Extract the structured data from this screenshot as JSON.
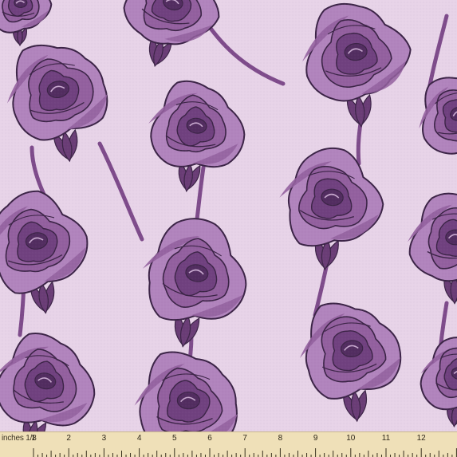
{
  "image": {
    "subject": "rose-pattern-fabric-swatch",
    "colors": {
      "background": "#e7d3e8",
      "petal_light": "#b184bd",
      "petal_mid": "#93609f",
      "petal_dark": "#70417f",
      "petal_deep": "#522d60",
      "outline": "#3c2447",
      "leaf": "#6a3d76",
      "stem": "#7e4b8b"
    }
  },
  "ruler": {
    "unit_label": "inches 1/8",
    "numbers": [
      "1",
      "2",
      "3",
      "4",
      "5",
      "6",
      "7",
      "8",
      "9",
      "10",
      "11",
      "12",
      "1"
    ],
    "colors": {
      "background": "#efe0b8",
      "ticks": "#3a3120"
    }
  }
}
